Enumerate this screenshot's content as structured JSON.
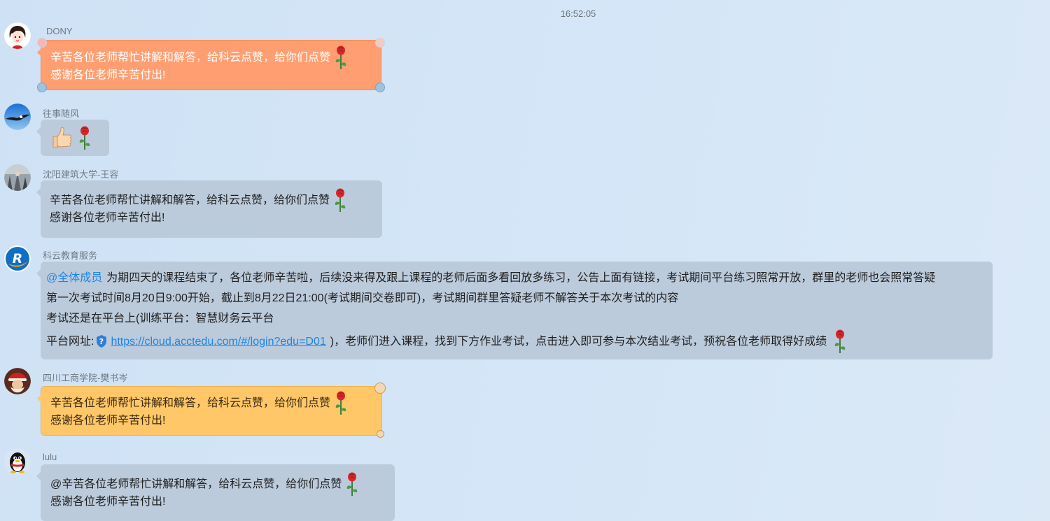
{
  "timestamp": "16:52:05",
  "messages": [
    {
      "sender": "DONY",
      "avatar_icon": "girl-avatar-icon",
      "bubble_style": "orange",
      "lines": [
        "辛苦各位老师帮忙讲解和解答，给科云点赞，给你们点赞",
        "感谢各位老师辛苦付出!"
      ],
      "emoji": "rose-icon"
    },
    {
      "sender": "往事随风",
      "avatar_icon": "eagle-avatar-icon",
      "bubble_style": "grey",
      "emojis": [
        "thumbs-up-icon",
        "rose-icon"
      ]
    },
    {
      "sender": "沈阳建筑大学-王容",
      "avatar_icon": "photo-avatar-icon",
      "bubble_style": "grey",
      "lines": [
        "辛苦各位老师帮忙讲解和解答，给科云点赞，给你们点赞",
        "感谢各位老师辛苦付出!"
      ],
      "emoji": "rose-icon"
    },
    {
      "sender": "科云教育服务",
      "avatar_icon": "keyun-logo-icon",
      "bubble_style": "grey",
      "mention": "@全体成员",
      "line1": "为期四天的课程结束了，各位老师辛苦啦，后续没来得及跟上课程的老师后面多看回放多练习，公告上面有链接，考试期间平台练习照常开放，群里的老师也会照常答疑",
      "line2": "第一次考试时间8月20日9:00开始，截止到8月22日21:00(考试期间交卷即可)，考试期间群里答疑老师不解答关于本次考试的内容",
      "line3": "考试还是在平台上(训练平台：智慧财务云平台",
      "line4_prefix": "平台网址:",
      "link": "https://cloud.acctedu.com/#/login?edu=D01",
      "line4_suffix": ")，老师们进入课程，找到下方作业考试，点击进入即可参与本次结业考试，预祝各位老师取得好成绩",
      "emoji": "rose-icon"
    },
    {
      "sender": "四川工商学院-樊书岑",
      "avatar_icon": "santa-avatar-icon",
      "bubble_style": "yellow",
      "lines": [
        "辛苦各位老师帮忙讲解和解答，给科云点赞，给你们点赞",
        "感谢各位老师辛苦付出!"
      ],
      "emoji": "rose-icon"
    },
    {
      "sender": "lulu",
      "avatar_icon": "penguin-avatar-icon",
      "bubble_style": "grey",
      "lines": [
        "@辛苦各位老师帮忙讲解和解答，给科云点赞，给你们点赞",
        "感谢各位老师辛苦付出!"
      ],
      "emoji": "rose-icon"
    }
  ]
}
